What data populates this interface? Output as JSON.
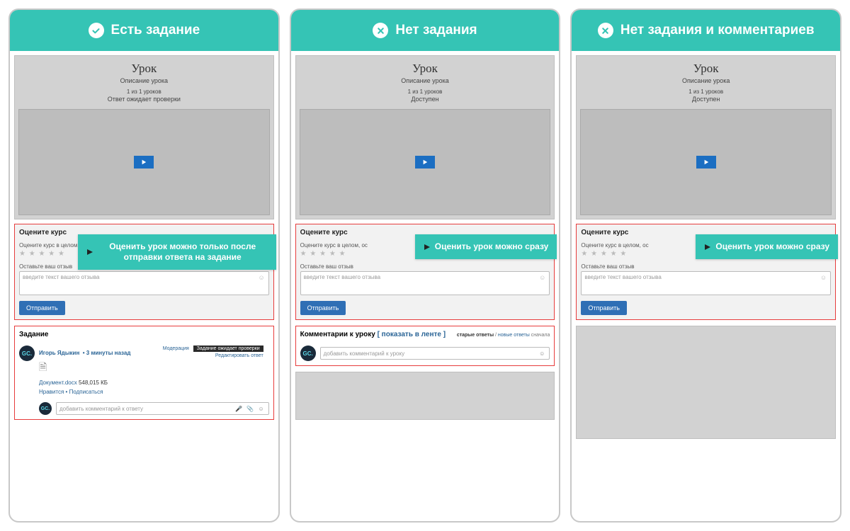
{
  "cards": [
    {
      "header_icon": "check",
      "header_title": "Есть задание",
      "lesson": {
        "title": "Урок",
        "desc": "Описание урока",
        "count": "1 из 1 уроков",
        "status": "Ответ ожидает проверки"
      },
      "rating": {
        "title": "Оцените курс",
        "sub": "Оцените курс в целом,",
        "review_label": "Оставьте ваш отзыв",
        "placeholder": "введите текст вашего отзыва",
        "send": "Отправить"
      },
      "callout": "Оценить урок можно только после отправки ответа на задание",
      "task": {
        "title": "Задание",
        "author": "Игорь Ядыкин",
        "time": "• 3 минуты назад",
        "moderation": "Модерация",
        "badge": "Задание ожидает проверки",
        "edit": "Редактировать ответ",
        "file_name": "Документ.docx",
        "file_size": "548,015 КБ",
        "like": "Нравится",
        "subscribe": "Подписаться",
        "comment_placeholder": "добавить комментарий к ответу"
      }
    },
    {
      "header_icon": "cross",
      "header_title": "Нет задания",
      "lesson": {
        "title": "Урок",
        "desc": "Описание урока",
        "count": "1 из 1 уроков",
        "status": "Доступен"
      },
      "rating": {
        "title": "Оцените курс",
        "sub": "Оцените курс в целом, ос",
        "review_label": "Оставьте ваш отзыв",
        "placeholder": "введите текст вашего отзыва",
        "send": "Отправить"
      },
      "callout": "Оценить урок можно сразу",
      "comments": {
        "title": "Комментарии к уроку",
        "show": "[ показать в ленте ]",
        "sort_old": "старые ответы",
        "sort_new": "новые ответы",
        "sort_suffix": "сначала",
        "placeholder": "добавить комментарий к уроку"
      }
    },
    {
      "header_icon": "cross",
      "header_title": "Нет задания и комментариев",
      "lesson": {
        "title": "Урок",
        "desc": "Описание урока",
        "count": "1 из 1 уроков",
        "status": "Доступен"
      },
      "rating": {
        "title": "Оцените курс",
        "sub": "Оцените курс в целом, ос",
        "review_label": "Оставьте ваш отзыв",
        "placeholder": "введите текст вашего отзыва",
        "send": "Отправить"
      },
      "callout": "Оценить урок можно сразу"
    }
  ],
  "avatar_text": "GC."
}
